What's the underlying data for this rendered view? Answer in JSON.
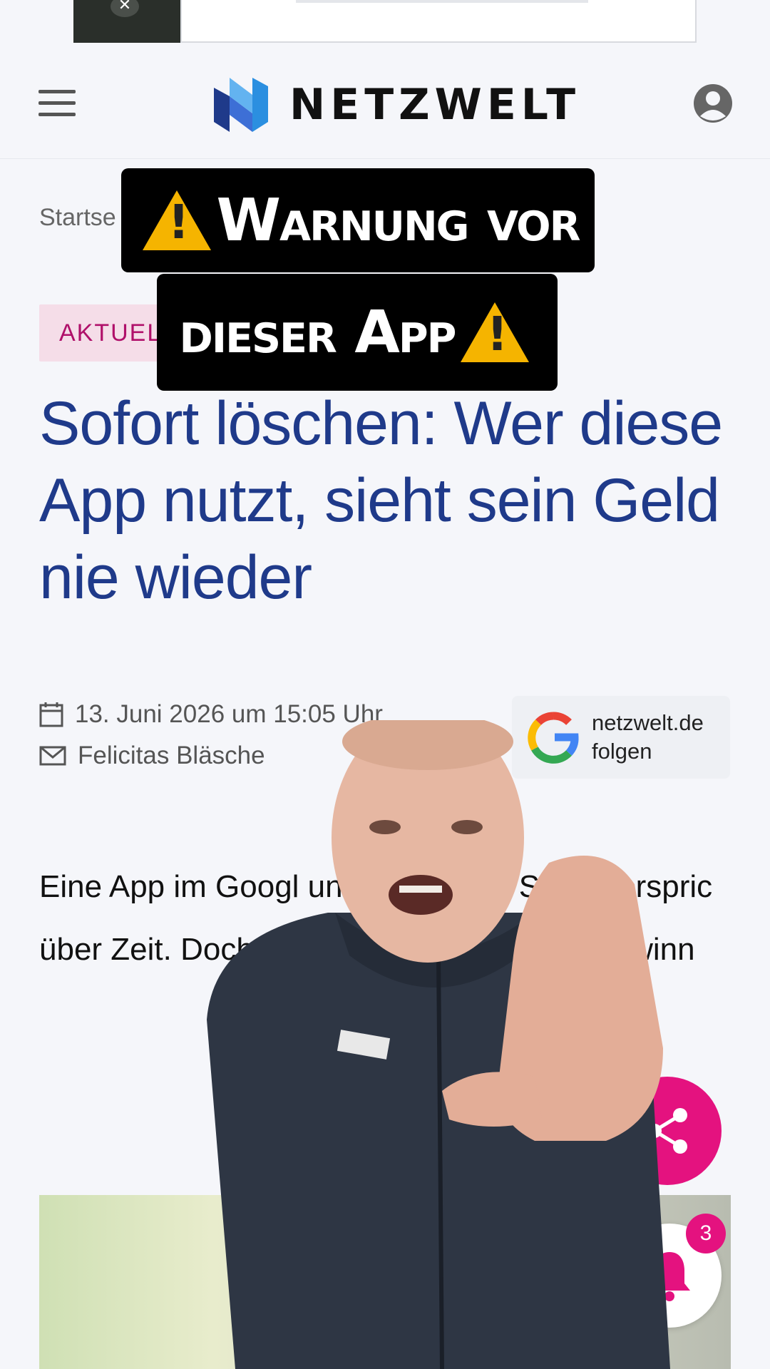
{
  "header": {
    "logo_text": "NETZWELT"
  },
  "breadcrumb": "Startse",
  "tag": "AKTUEL",
  "overlay_caption": {
    "line1": "Warnung vor",
    "line2": "dieser App"
  },
  "headline": "Sofort löschen: Wer diese App nutzt, sieht sein Geld nie wieder",
  "meta": {
    "date": "13. Juni 2026 um 15:05 Uhr",
    "author": "Felicitas Bläsche"
  },
  "google_follow": {
    "line1": "netzwelt.de",
    "line2": "folgen"
  },
  "body_text": "Eine App im Googl und Apple App Store verspric über Zeit. Doch wer die Ap tüchtig - die Gewinn",
  "notifications": {
    "count": "3"
  },
  "colors": {
    "headline": "#1f3a8a",
    "accent": "#e4127f",
    "tag_bg": "#f5dde8"
  }
}
